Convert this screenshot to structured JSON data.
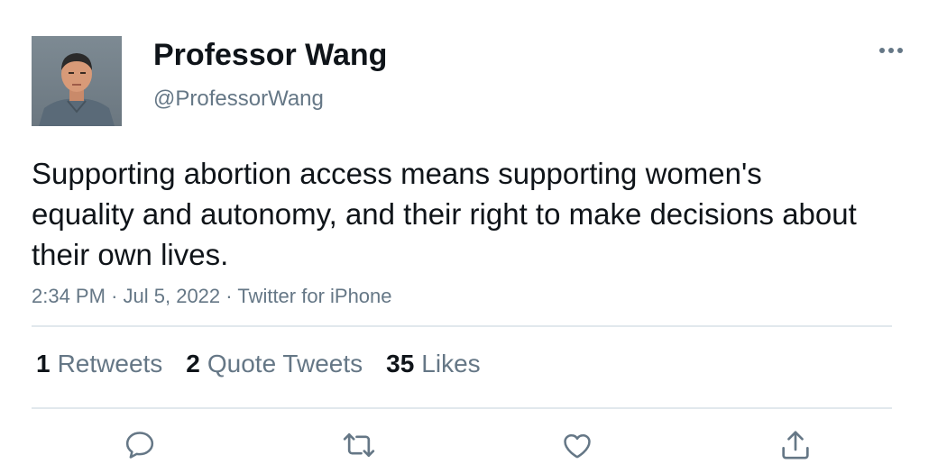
{
  "user": {
    "display_name": "Professor Wang",
    "handle": "@ProfessorWang"
  },
  "tweet": {
    "text": "Supporting abortion access means supporting women's equality and autonomy, and their right to make decisions about their own lives.",
    "time": "2:34 PM",
    "date": "Jul 5, 2022",
    "source": "Twitter for iPhone",
    "separator": "·"
  },
  "stats": {
    "retweets_count": "1",
    "retweets_label": "Retweets",
    "quotes_count": "2",
    "quotes_label": "Quote Tweets",
    "likes_count": "35",
    "likes_label": "Likes"
  },
  "actions": {
    "reply_icon": "reply-icon",
    "retweet_icon": "retweet-icon",
    "like_icon": "heart-icon",
    "share_icon": "share-icon"
  },
  "colors": {
    "text_primary": "#0f1419",
    "text_secondary": "#657786",
    "divider": "#e1e8ed"
  }
}
